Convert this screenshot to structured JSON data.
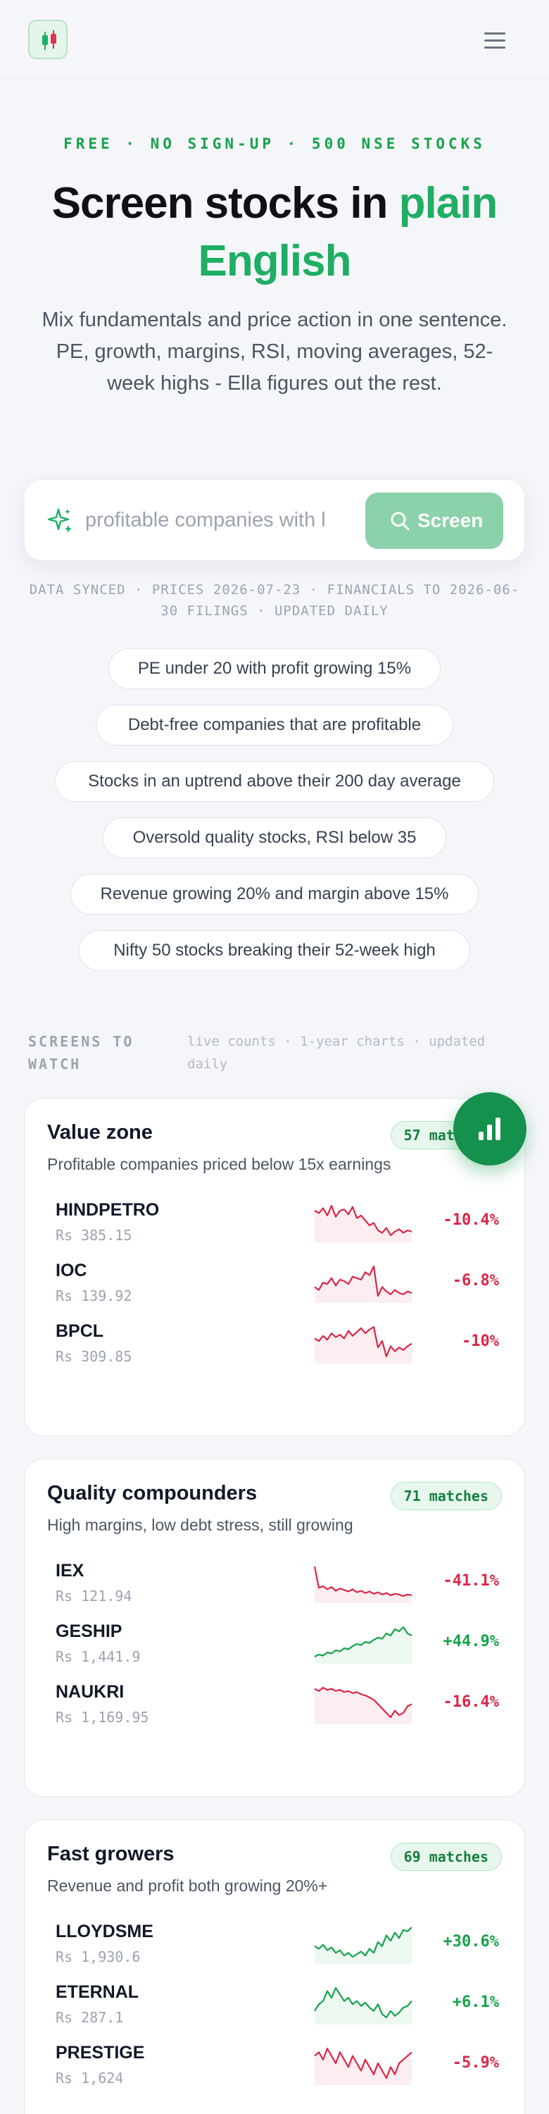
{
  "header": {
    "logo_icon": "candlestick-icon",
    "menu_icon": "hamburger-menu-icon"
  },
  "hero": {
    "tagline": "FREE · NO SIGN-UP · 500 NSE STOCKS",
    "headline_part1": "Screen stocks in ",
    "headline_accent1": "plain",
    "headline_accent2": "English",
    "subtitle": "Mix fundamentals and price action in one sentence. PE, growth, margins, RSI, moving averages, 52-week highs - Ella figures out the rest."
  },
  "search": {
    "icon": "sparkle-icon",
    "value": "profitable companies with l",
    "button_label": "Screen",
    "button_icon": "search-icon"
  },
  "meta": {
    "text": "DATA SYNCED · PRICES 2026-07-23 · FINANCIALS TO 2026-06-30 FILINGS · UPDATED DAILY"
  },
  "suggestions": [
    "PE under 20 with profit growing 15%",
    "Debt-free companies that are profitable",
    "Stocks in an uptrend above their 200 day average",
    "Oversold quality stocks, RSI below 35",
    "Revenue growing 20% and margin above 15%",
    "Nifty 50 stocks breaking their 52-week high"
  ],
  "screens_section": {
    "title": "SCREENS TO WATCH",
    "note": "live counts · 1-year charts · updated daily"
  },
  "fab": {
    "icon": "bar-chart-icon"
  },
  "colors": {
    "accent": "#1fae63",
    "positive": "#16a34a",
    "negative": "#dc2646",
    "button": "#8bd1a9"
  },
  "cards": [
    {
      "title": "Value zone",
      "badge": "57 matches",
      "desc": "Profitable companies priced below 15x earnings",
      "stocks": [
        {
          "ticker": "HINDPETRO",
          "price": "Rs 385.15",
          "change": "-10.4%",
          "dir": "neg",
          "spark": [
            70,
            68,
            72,
            66,
            74,
            65,
            70,
            71,
            67,
            73,
            64,
            66,
            62,
            58,
            60,
            54,
            52,
            56,
            50,
            53,
            55,
            52,
            54,
            53
          ]
        },
        {
          "ticker": "IOC",
          "price": "Rs 139.92",
          "change": "-6.8%",
          "dir": "neg",
          "spark": [
            60,
            58,
            63,
            62,
            66,
            61,
            65,
            64,
            62,
            67,
            66,
            65,
            70,
            68,
            74,
            54,
            60,
            57,
            55,
            58,
            56,
            55,
            57,
            56
          ]
        },
        {
          "ticker": "BPCL",
          "price": "Rs 309.85",
          "change": "-10%",
          "dir": "neg",
          "spark": [
            64,
            62,
            66,
            63,
            68,
            65,
            67,
            64,
            70,
            66,
            69,
            72,
            68,
            71,
            73,
            57,
            62,
            50,
            58,
            54,
            57,
            55,
            58,
            60
          ]
        }
      ]
    },
    {
      "title": "Quality compounders",
      "badge": "71 matches",
      "desc": "High margins, low debt stress, still growing",
      "stocks": [
        {
          "ticker": "IEX",
          "price": "Rs 121.94",
          "change": "-41.1%",
          "dir": "neg",
          "spark": [
            90,
            62,
            64,
            60,
            63,
            58,
            61,
            59,
            57,
            60,
            56,
            58,
            55,
            57,
            54,
            56,
            53,
            55,
            52,
            54,
            53,
            51,
            53,
            52
          ]
        },
        {
          "ticker": "GESHIP",
          "price": "Rs 1,441.9",
          "change": "+44.9%",
          "dir": "pos",
          "spark": [
            40,
            42,
            41,
            44,
            43,
            46,
            45,
            48,
            47,
            50,
            52,
            51,
            54,
            53,
            56,
            58,
            57,
            62,
            60,
            66,
            64,
            68,
            62,
            60
          ]
        },
        {
          "ticker": "NAUKRI",
          "price": "Rs 1,169.95",
          "change": "-16.4%",
          "dir": "neg",
          "spark": [
            70,
            68,
            71,
            69,
            70,
            68,
            69,
            67,
            68,
            66,
            67,
            65,
            64,
            62,
            60,
            56,
            52,
            48,
            44,
            50,
            46,
            48,
            54,
            56
          ]
        }
      ]
    },
    {
      "title": "Fast growers",
      "badge": "69 matches",
      "desc": "Revenue and profit both growing 20%+",
      "stocks": [
        {
          "ticker": "LLOYDSME",
          "price": "Rs 1,930.6",
          "change": "+30.6%",
          "dir": "pos",
          "spark": [
            52,
            50,
            53,
            49,
            51,
            47,
            49,
            45,
            47,
            44,
            46,
            48,
            45,
            50,
            47,
            55,
            52,
            60,
            56,
            62,
            58,
            64,
            63,
            66
          ]
        },
        {
          "ticker": "ETERNAL",
          "price": "Rs 287.1",
          "change": "+6.1%",
          "dir": "pos",
          "spark": [
            52,
            56,
            58,
            64,
            60,
            66,
            62,
            58,
            60,
            56,
            58,
            55,
            57,
            54,
            52,
            56,
            50,
            48,
            52,
            49,
            51,
            54,
            55,
            58
          ]
        },
        {
          "ticker": "PRESTIGE",
          "price": "Rs 1,624",
          "change": "-5.9%",
          "dir": "neg",
          "spark": [
            60,
            62,
            58,
            64,
            60,
            56,
            62,
            58,
            54,
            60,
            56,
            52,
            58,
            54,
            50,
            56,
            52,
            48,
            54,
            50,
            56,
            58,
            60,
            62
          ]
        }
      ]
    }
  ]
}
